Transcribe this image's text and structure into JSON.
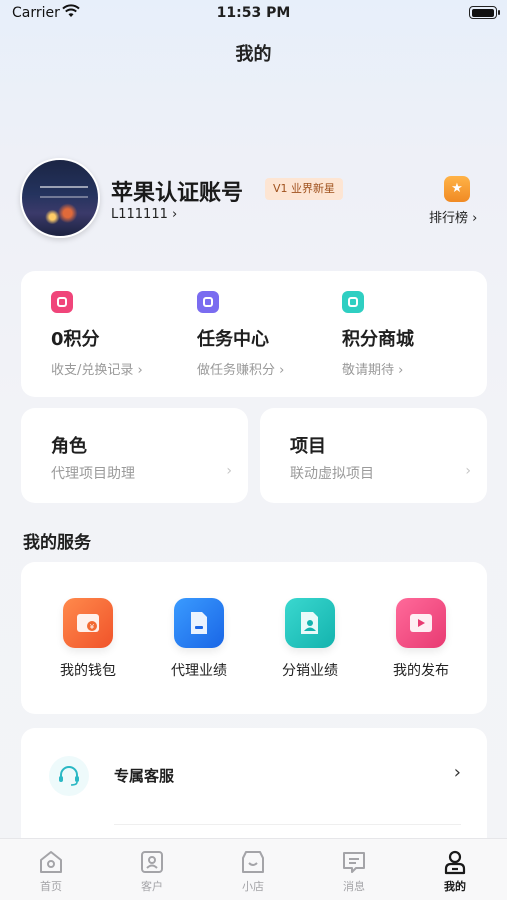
{
  "status_bar": {
    "carrier": "Carrier",
    "time": "11:53 PM"
  },
  "header": {
    "title": "我的"
  },
  "profile": {
    "name": "苹果认证账号",
    "level_badge": "V1 业界新星",
    "user_id": "L111111 ›",
    "rank_label": "排行榜 ›"
  },
  "stats": [
    {
      "title": "0积分",
      "subtitle": "收支/兑换记录 ›",
      "icon": "points-icon",
      "color": "#f0457a"
    },
    {
      "title": "任务中心",
      "subtitle": "做任务赚积分 ›",
      "icon": "task-icon",
      "color": "#7a6cf0"
    },
    {
      "title": "积分商城",
      "subtitle": "敬请期待 ›",
      "icon": "shop-icon",
      "color": "#2fcfc2"
    }
  ],
  "role_card": {
    "title": "角色",
    "subtitle": "代理项目助理",
    "arrow": "›"
  },
  "project_card": {
    "title": "项目",
    "subtitle": "联动虚拟项目",
    "arrow": "›"
  },
  "services": {
    "title": "我的服务",
    "items": [
      {
        "label": "我的钱包",
        "icon": "wallet-icon",
        "color": "#f26a32"
      },
      {
        "label": "代理业绩",
        "icon": "agent-performance-icon",
        "color": "#2b7ef5"
      },
      {
        "label": "分销业绩",
        "icon": "distribution-performance-icon",
        "color": "#26c6c0"
      },
      {
        "label": "我的发布",
        "icon": "publish-icon",
        "color": "#f0457a"
      }
    ]
  },
  "customer_service": {
    "label": "专属客服",
    "arrow": "›"
  },
  "tabbar": {
    "items": [
      {
        "label": "首页",
        "icon": "home-icon",
        "active": false
      },
      {
        "label": "客户",
        "icon": "customer-icon",
        "active": false
      },
      {
        "label": "小店",
        "icon": "store-icon",
        "active": false
      },
      {
        "label": "消息",
        "icon": "message-icon",
        "active": false
      },
      {
        "label": "我的",
        "icon": "profile-icon",
        "active": true
      }
    ]
  }
}
